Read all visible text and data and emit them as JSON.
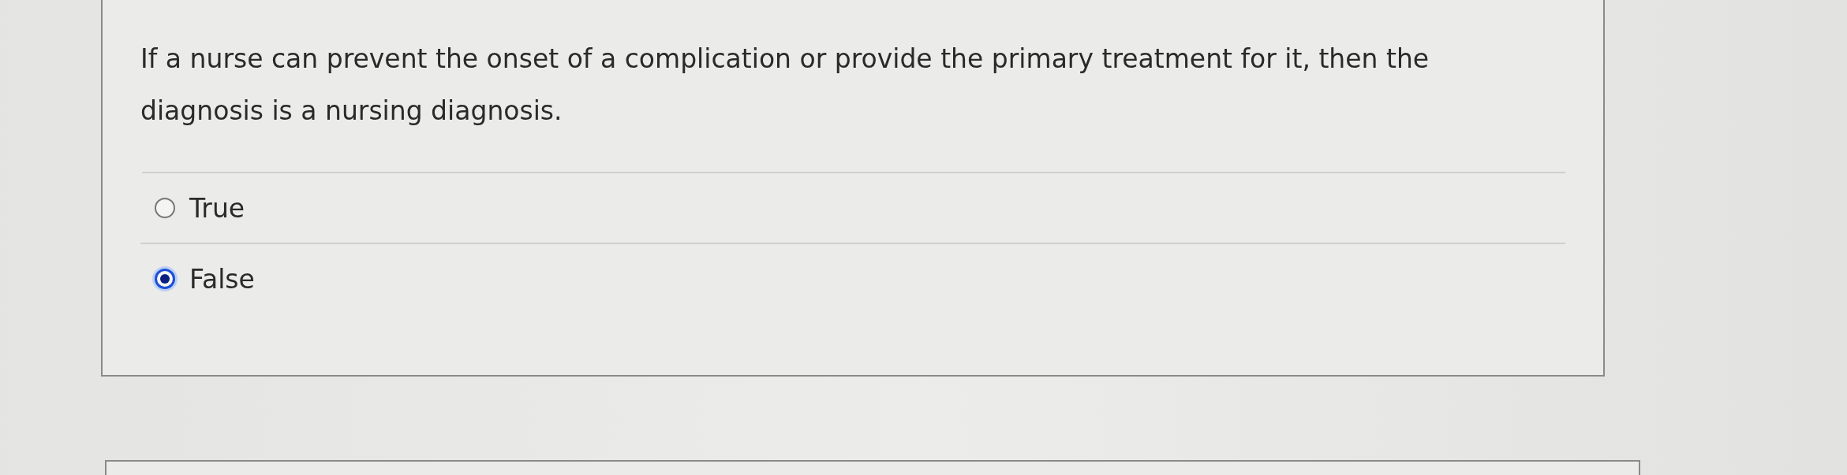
{
  "question": "If a nurse can prevent the onset of a complication or provide the primary treatment for it, then the diagnosis is a nursing diagnosis.",
  "options": [
    {
      "label": "True",
      "selected": false
    },
    {
      "label": "False",
      "selected": true
    }
  ]
}
